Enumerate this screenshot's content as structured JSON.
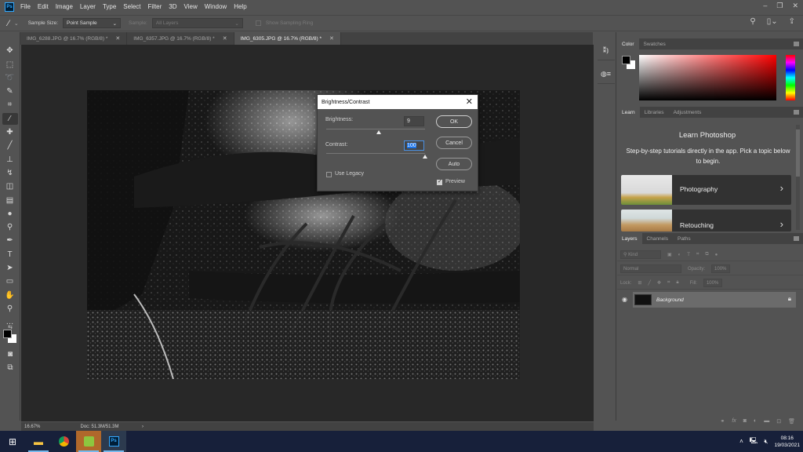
{
  "app": {
    "logo": "Ps",
    "name": "Adobe Photoshop"
  },
  "menu": [
    "File",
    "Edit",
    "Image",
    "Layer",
    "Type",
    "Select",
    "Filter",
    "3D",
    "View",
    "Window",
    "Help"
  ],
  "window_controls": {
    "minimize": "–",
    "restore": "❐",
    "close": "✕"
  },
  "options_bar": {
    "tool_icon": "eyedropper-icon",
    "sample_size_label": "Sample Size:",
    "sample_size_value": "Point Sample",
    "sample_label": "Sample:",
    "sample_value": "All Layers",
    "show_sampling_ring_label": "Show Sampling Ring",
    "show_sampling_ring_checked": false,
    "right_icons": [
      "search-icon",
      "workspace-icon",
      "share-icon"
    ]
  },
  "doc_tabs": [
    {
      "label": "IMG_6288.JPG @ 16.7% (RGB/8) *",
      "active": false
    },
    {
      "label": "IMG_6357.JPG @ 16.7% (RGB/8) *",
      "active": false
    },
    {
      "label": "IMG_6305.JPG @ 16.7% (RGB/8) *",
      "active": true
    }
  ],
  "tools": [
    {
      "name": "move-tool",
      "glyph": "✥"
    },
    {
      "name": "marquee-tool",
      "glyph": "⬚"
    },
    {
      "name": "lasso-tool",
      "glyph": "➰"
    },
    {
      "name": "quick-select-tool",
      "glyph": "✎"
    },
    {
      "name": "crop-tool",
      "glyph": "⌗"
    },
    {
      "name": "eyedropper-tool",
      "glyph": "⁄",
      "active": true
    },
    {
      "name": "healing-brush-tool",
      "glyph": "✚"
    },
    {
      "name": "brush-tool",
      "glyph": "╱"
    },
    {
      "name": "clone-stamp-tool",
      "glyph": "⊥"
    },
    {
      "name": "history-brush-tool",
      "glyph": "↯"
    },
    {
      "name": "eraser-tool",
      "glyph": "◫"
    },
    {
      "name": "gradient-tool",
      "glyph": "▤"
    },
    {
      "name": "blur-tool",
      "glyph": "●"
    },
    {
      "name": "dodge-tool",
      "glyph": "⚲"
    },
    {
      "name": "pen-tool",
      "glyph": "✒"
    },
    {
      "name": "type-tool",
      "glyph": "T"
    },
    {
      "name": "path-select-tool",
      "glyph": "➤"
    },
    {
      "name": "rectangle-tool",
      "glyph": "▭"
    },
    {
      "name": "hand-tool",
      "glyph": "✋"
    },
    {
      "name": "zoom-tool",
      "glyph": "⚲"
    },
    {
      "name": "more-tools",
      "glyph": "…"
    }
  ],
  "status_bar": {
    "zoom": "16.67%",
    "doc_info": "Doc: 51.3M/51.3M",
    "arrow": "›"
  },
  "dialog": {
    "title": "Brightness/Contrast",
    "brightness_label": "Brightness:",
    "brightness_value": "9",
    "brightness_min": -150,
    "brightness_max": 150,
    "contrast_label": "Contrast:",
    "contrast_value": "100",
    "contrast_min": -50,
    "contrast_max": 100,
    "use_legacy_label": "Use Legacy",
    "use_legacy_checked": false,
    "preview_label": "Preview",
    "preview_checked": true,
    "ok_label": "OK",
    "cancel_label": "Cancel",
    "auto_label": "Auto"
  },
  "color_panel": {
    "tabs": [
      "Color",
      "Swatches"
    ],
    "foreground": "#000000",
    "background": "#ffffff",
    "hue": "#ff0000"
  },
  "learn_panel": {
    "tabs": [
      "Learn",
      "Libraries",
      "Adjustments"
    ],
    "title": "Learn Photoshop",
    "description": "Step-by-step tutorials directly in the app. Pick a topic below to begin.",
    "cards": [
      {
        "label": "Photography"
      },
      {
        "label": "Retouching"
      }
    ]
  },
  "layers_panel": {
    "tabs": [
      "Layers",
      "Channels",
      "Paths"
    ],
    "filter_placeholder": "Kind",
    "blend_mode": "Normal",
    "opacity_label": "Opacity:",
    "opacity_value": "100%",
    "lock_label": "Lock:",
    "fill_label": "Fill:",
    "fill_value": "100%",
    "layers": [
      {
        "name": "Background",
        "visible": true,
        "locked": true
      }
    ],
    "footer_icons": [
      "link-icon",
      "fx-icon",
      "mask-icon",
      "adjustment-icon",
      "group-icon",
      "new-layer-icon",
      "trash-icon"
    ]
  },
  "taskbar": {
    "apps": [
      "start",
      "file-explorer",
      "chrome",
      "green-app",
      "photoshop"
    ],
    "clock_time": "08:16",
    "clock_date": "19/03/2021"
  }
}
